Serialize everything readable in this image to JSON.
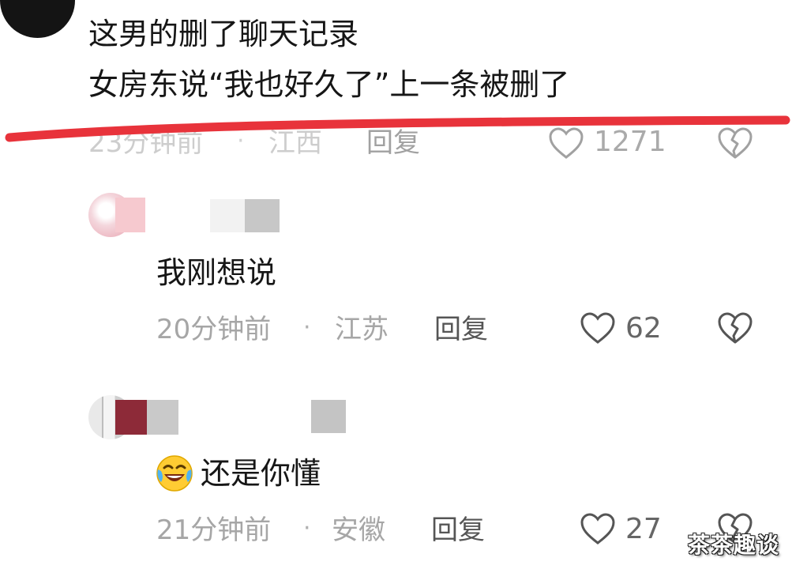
{
  "top_comment": {
    "line1": "这男的删了聊天记录",
    "line2": "女房东说“我也好久了”上一条被删了",
    "time": "23分钟前",
    "location": "江西",
    "reply_label": "回复",
    "likes": "1271"
  },
  "replies": [
    {
      "text": "我刚想说",
      "time": "20分钟前",
      "location": "江苏",
      "reply_label": "回复",
      "likes": "62"
    },
    {
      "text": "还是你懂",
      "emoji": "laughing-tears-emoji",
      "time": "21分钟前",
      "location": "安徽",
      "reply_label": "回复",
      "likes": "27"
    }
  ],
  "separator": "·",
  "watermark": "茶茶趣谈",
  "colors": {
    "annotation_red": "#e8333b",
    "meta_gray": "#a6a6a6",
    "text": "#161616"
  },
  "icons": [
    "heart-icon",
    "broken-heart-icon"
  ]
}
